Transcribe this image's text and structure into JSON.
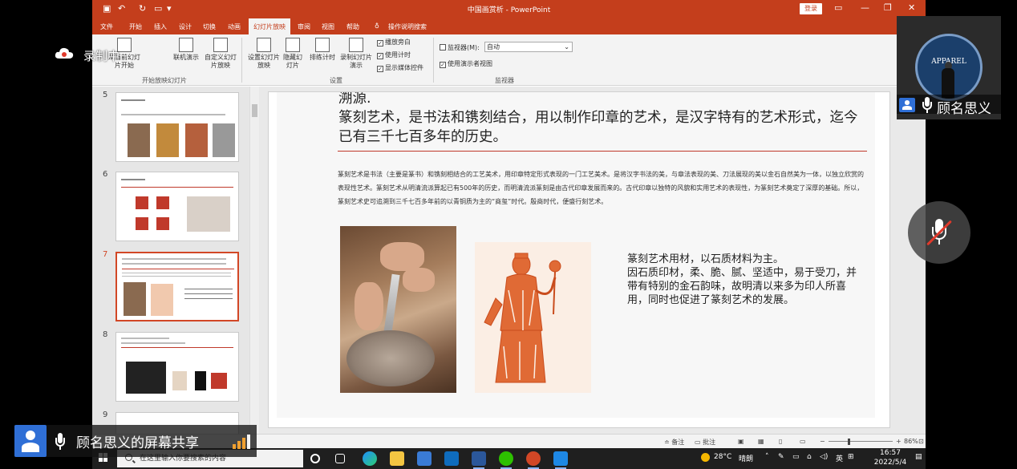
{
  "window": {
    "doc_title": "中国画赏析 - PowerPoint",
    "login_label": "登录"
  },
  "ribbon_tabs": [
    "文件",
    "开始",
    "插入",
    "设计",
    "切换",
    "动画",
    "幻灯片放映",
    "审阅",
    "视图",
    "帮助",
    "操作说明搜索"
  ],
  "active_tab": "幻灯片放映",
  "ribbon": {
    "btn_from_current": "从当前幻灯片开始",
    "btn_online": "联机演示",
    "btn_custom": "自定义幻灯片放映",
    "group_start": "开始放映幻灯片",
    "btn_setup": "设置幻灯片放映",
    "btn_hide": "隐藏幻灯片",
    "btn_rehearse": "排练计时",
    "btn_record": "录制幻灯片演示",
    "chk_narration": "播放旁白",
    "chk_timings": "使用计时",
    "chk_media": "显示媒体控件",
    "group_setup": "设置",
    "monitor_label": "监视器(M):",
    "monitor_value": "自动",
    "chk_presenter": "使用演示者视图",
    "group_monitor": "监视器"
  },
  "thumbnails": {
    "numbers": [
      "5",
      "6",
      "7",
      "8",
      "9"
    ],
    "selected": "7"
  },
  "slide": {
    "heading_partial": "溯源.",
    "heading": "篆刻艺术，是书法和镌刻结合，用以制作印章的艺术，是汉字特有的艺术形式，迄今已有三千七百多年的历史。",
    "body": "篆刻艺术是书法（主要是篆书）和镌刻相结合的工艺美术，用印章特定形式表现的一门工艺美术。是将汉字书法的美，与章法表现的美、刀法展现的美以金石自然美为一体，以独立欣赏的表现性艺术。篆刻艺术从明清流派算起已有500年的历史，而明清流派篆刻是由古代印章发展而来的。古代印章以独特的风貌和实用艺术的表现性，为篆刻艺术奠定了深厚的基础。所以，篆刻艺术史可追溯到三千七百多年前的以青铜质为主的“商玺”时代。殷商时代，便盛行刻艺术。",
    "side_text_1": "篆刻艺术用材，以石质材料为主。",
    "side_text_2": "因石质印材，柔、脆、腻、坚适中，易于受刀，并带有特别的金石韵味，故明清以来多为印人所喜用，同时也促进了篆刻艺术的发展。"
  },
  "statusbar": {
    "notes": "备注",
    "comments": "批注",
    "zoom": "86%"
  },
  "taskbar": {
    "search_placeholder": "在这里输入你要搜索的内容",
    "weather": "28°C",
    "weather_desc": "晴朗",
    "ime": "英",
    "time": "16:57",
    "date": "2022/5/4"
  },
  "meeting": {
    "recording_label": "录制中",
    "participant_name": "顾名思义",
    "share_label": "顾名思义的屏幕共享",
    "avatar_logo": "APPAREL",
    "accent": "#2f6fd6",
    "mute_slash_color": "#e0392b"
  },
  "colors": {
    "ppt_accent": "#c43e1c",
    "slide_rule": "#c0392b"
  }
}
